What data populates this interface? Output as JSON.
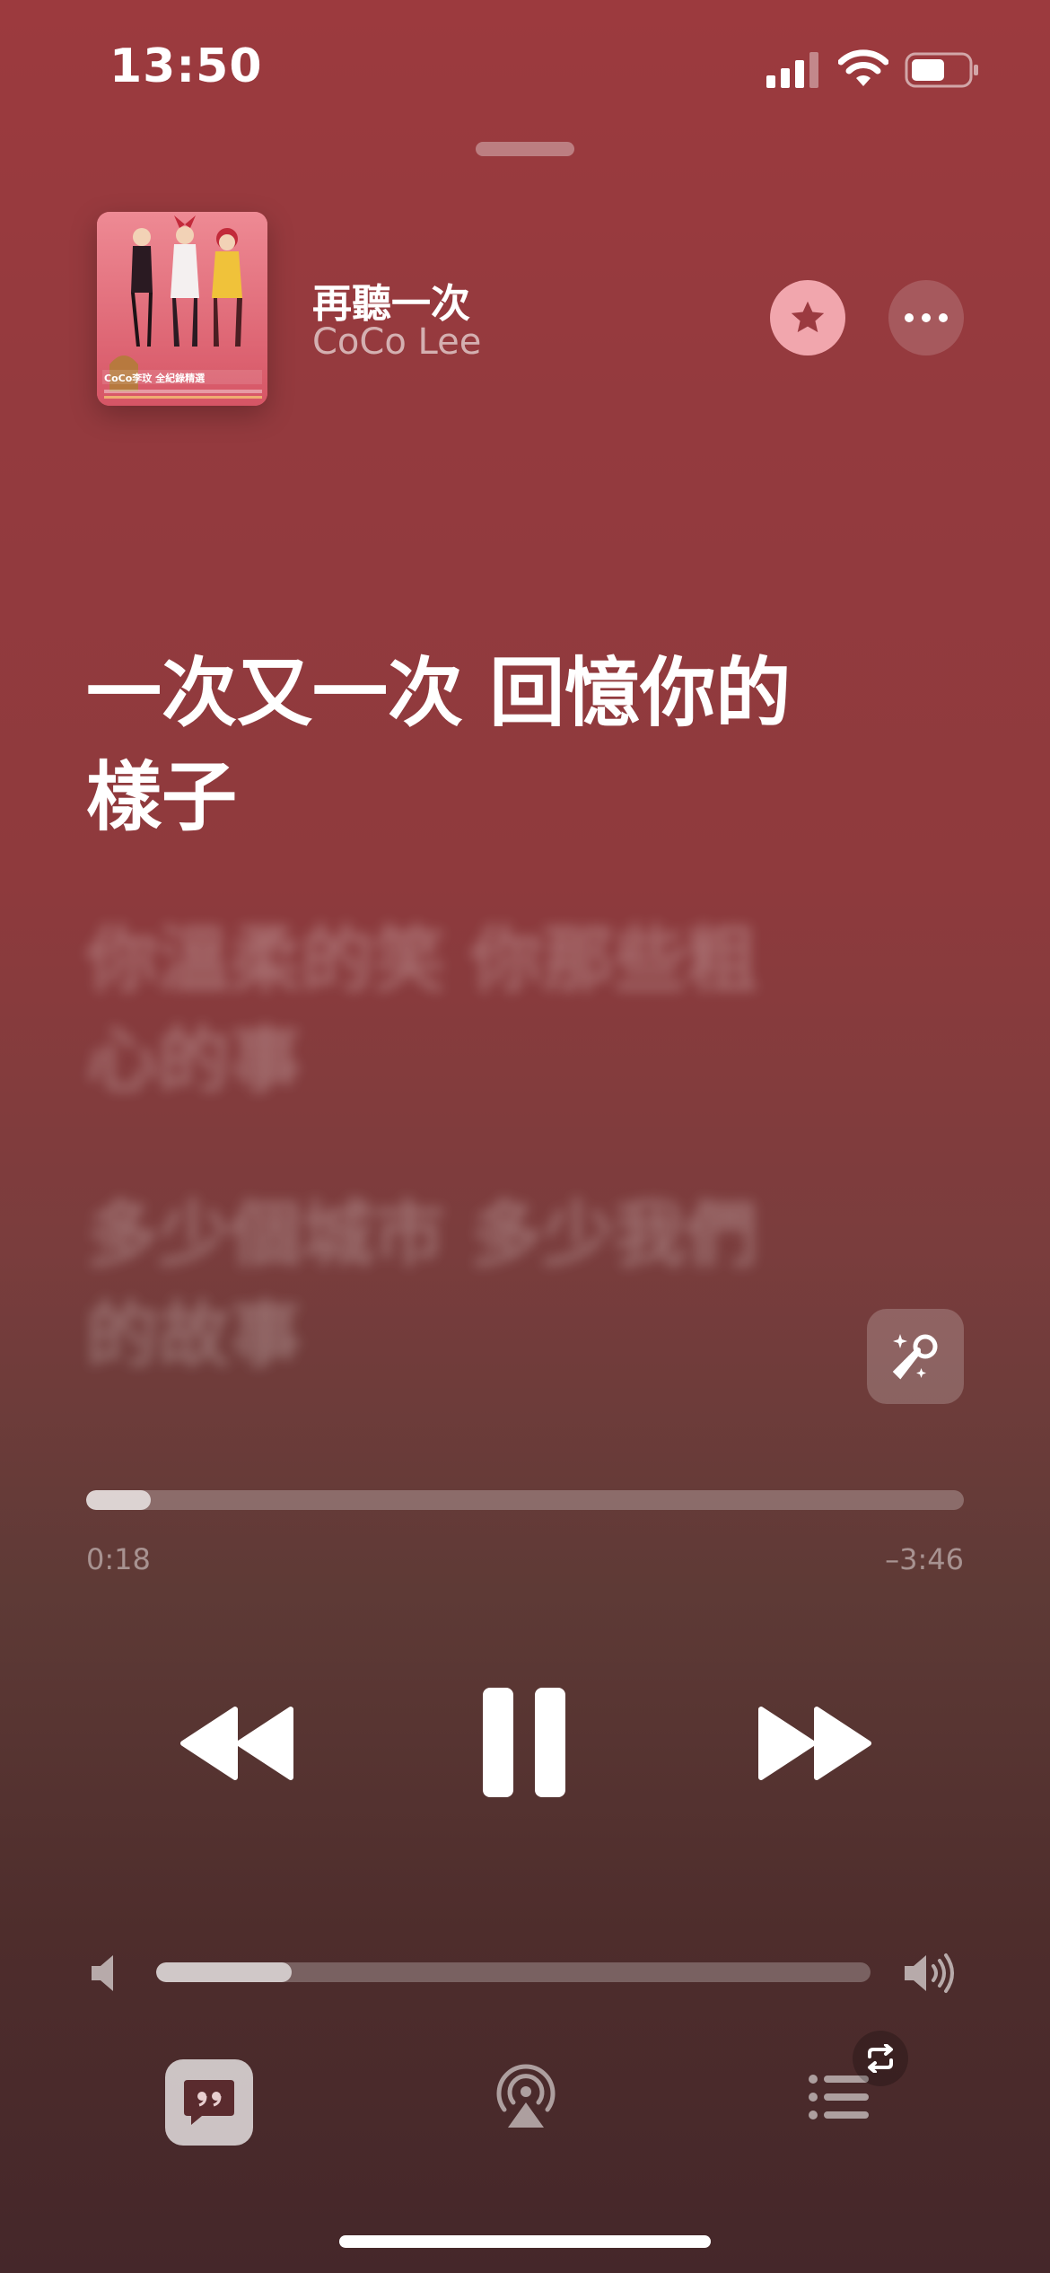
{
  "status_bar": {
    "time": "13:50"
  },
  "now_playing": {
    "title": "再聽一次",
    "artist": "CoCo Lee",
    "album_art_text": "CoCo李玟 全紀錄精選"
  },
  "lyrics": {
    "active": "一次又一次 回憶你的樣子",
    "next": [
      "你溫柔的笑 你那些粗心的事",
      "多少個城市 多少我們的故事"
    ]
  },
  "progress": {
    "elapsed": "0:18",
    "remaining": "–3:46",
    "fraction": 0.074
  },
  "volume": {
    "fraction": 0.19
  },
  "colors": {
    "accent_star_bg": "#f1a6ad",
    "accent_star_icon": "#9b3a40"
  },
  "icons": [
    "star-icon",
    "more-icon",
    "sing-icon",
    "rewind-icon",
    "pause-icon",
    "forward-icon",
    "volume-low-icon",
    "volume-high-icon",
    "lyrics-icon",
    "airplay-icon",
    "queue-icon",
    "repeat-icon"
  ]
}
